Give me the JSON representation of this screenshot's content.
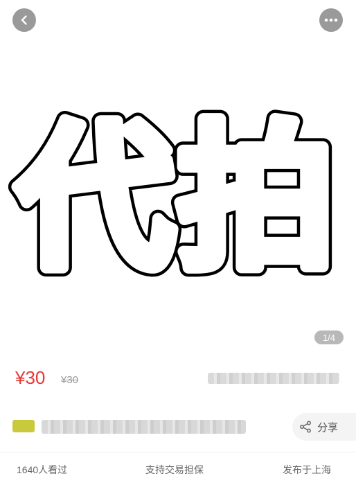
{
  "hero": {
    "headline": "代拍",
    "image_counter": "1/4"
  },
  "price": {
    "current": "¥30",
    "original": "¥30"
  },
  "actions": {
    "share_label": "分享"
  },
  "stats": {
    "views": "1640人看过",
    "guarantee": "支持交易担保",
    "location": "发布于上海"
  },
  "icons": [
    "back-chevron-icon",
    "more-dots-icon",
    "share-icon"
  ],
  "colors": {
    "price_red": "#e53935",
    "icon_button_gray": "#9a9a9a",
    "seller_tag": "#c9c93c"
  }
}
